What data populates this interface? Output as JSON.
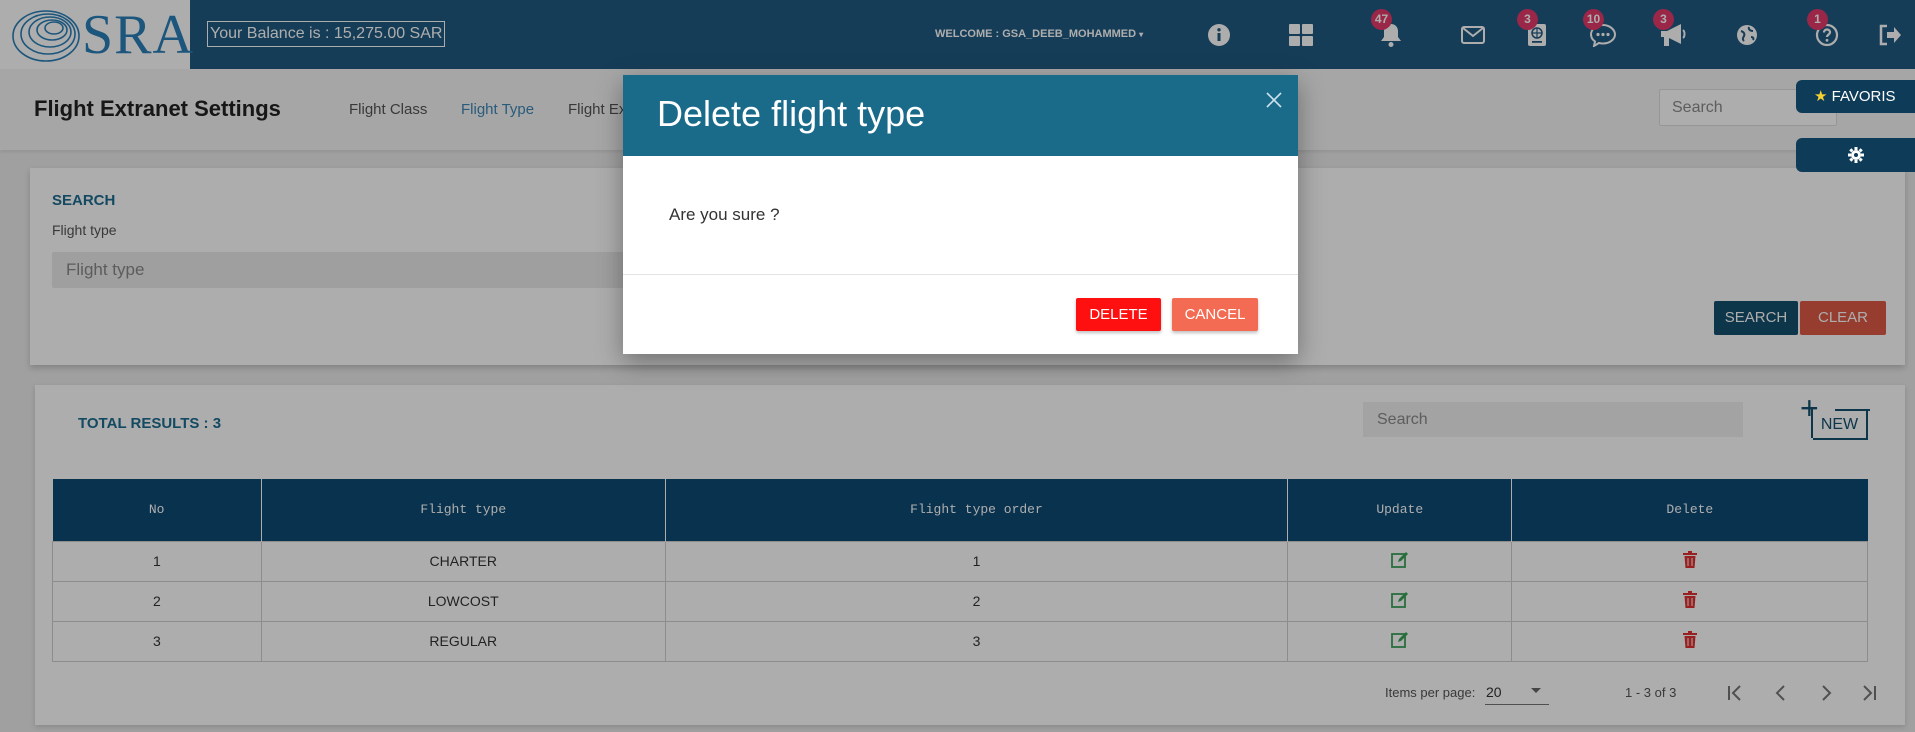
{
  "header": {
    "logo_text": "SRA",
    "balance": "Your Balance is : 15,275.00 SAR",
    "welcome": "WELCOME : GSA_DEEB_MOHAMMED",
    "icons": [
      {
        "name": "info-icon",
        "badge": ""
      },
      {
        "name": "dashboard-grid-icon",
        "badge": ""
      },
      {
        "name": "bell-icon",
        "badge": "47"
      },
      {
        "name": "mail-icon",
        "badge": ""
      },
      {
        "name": "passport-icon",
        "badge": "3"
      },
      {
        "name": "chat-icon",
        "badge": "10"
      },
      {
        "name": "megaphone-icon",
        "badge": "3"
      },
      {
        "name": "globe-icon",
        "badge": ""
      },
      {
        "name": "help-icon",
        "badge": "1"
      },
      {
        "name": "logout-icon",
        "badge": ""
      }
    ]
  },
  "page": {
    "title": "Flight Extranet Settings",
    "tabs": [
      "Flight Class",
      "Flight Type",
      "Flight Ex"
    ],
    "active_tab": "Flight Type",
    "search_placeholder": "Search"
  },
  "side": {
    "favoris": "FAVORIS"
  },
  "search_card": {
    "title": "SEARCH",
    "field_label": "Flight type",
    "field_placeholder": "Flight type",
    "search_button": "SEARCH",
    "clear_button": "CLEAR"
  },
  "results": {
    "total": "TOTAL RESULTS : 3",
    "search_placeholder": "Search",
    "new_button": "NEW",
    "columns": [
      "No",
      "Flight type",
      "Flight type order",
      "Update",
      "Delete"
    ],
    "rows": [
      {
        "no": "1",
        "type": "CHARTER",
        "order": "1"
      },
      {
        "no": "2",
        "type": "LOWCOST",
        "order": "2"
      },
      {
        "no": "3",
        "type": "REGULAR",
        "order": "3"
      }
    ],
    "items_per_page_label": "Items per page:",
    "items_per_page": "20",
    "range": "1 - 3 of 3"
  },
  "dialog": {
    "title": "Delete flight type",
    "message": "Are you sure ?",
    "delete_button": "DELETE",
    "cancel_button": "CANCEL"
  },
  "colors": {
    "topbar": "#215a82",
    "dialog_header": "#1a6a8a",
    "delete": "#ff1010",
    "cancel": "#f26b52",
    "table_header": "#0e4a74",
    "badge": "#e4386a"
  }
}
